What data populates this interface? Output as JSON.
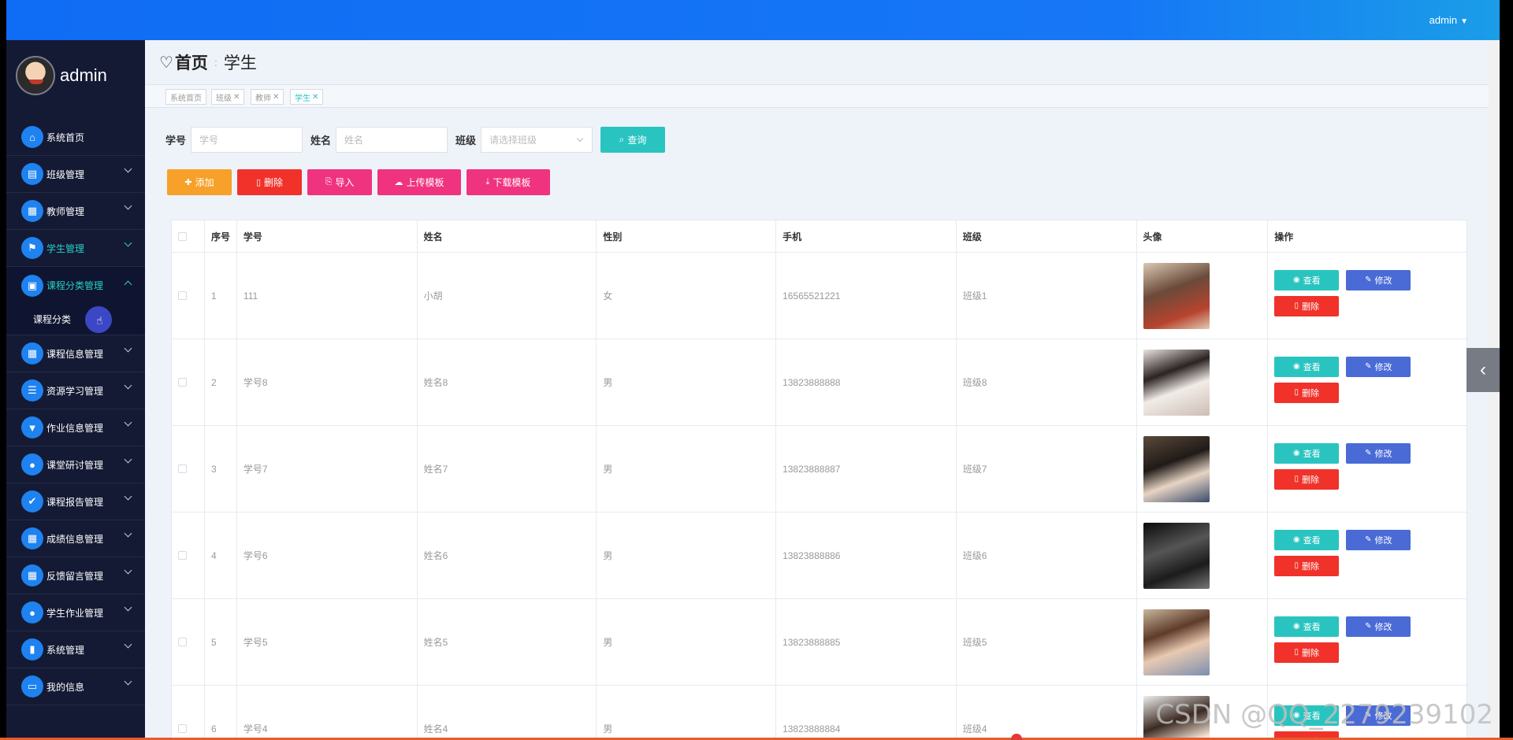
{
  "header": {
    "username": "admin"
  },
  "sidebar": {
    "brand_name": "admin",
    "items": [
      {
        "label": "系统首页",
        "icon": "home-icon"
      },
      {
        "label": "班级管理",
        "icon": "chart-icon"
      },
      {
        "label": "教师管理",
        "icon": "grid-icon"
      },
      {
        "label": "学生管理",
        "icon": "flag-icon"
      },
      {
        "label": "课程分类管理",
        "icon": "briefcase-icon"
      },
      {
        "label": "课程信息管理",
        "icon": "grid-icon"
      },
      {
        "label": "资源学习管理",
        "icon": "list-icon"
      },
      {
        "label": "作业信息管理",
        "icon": "pin-icon"
      },
      {
        "label": "课堂研讨管理",
        "icon": "user-icon"
      },
      {
        "label": "课程报告管理",
        "icon": "clipboard-icon"
      },
      {
        "label": "成绩信息管理",
        "icon": "grid-icon"
      },
      {
        "label": "反馈留言管理",
        "icon": "grid-icon"
      },
      {
        "label": "学生作业管理",
        "icon": "bulb-icon"
      },
      {
        "label": "系统管理",
        "icon": "bar-chart-icon"
      },
      {
        "label": "我的信息",
        "icon": "id-card-icon"
      }
    ],
    "sub_item": "课程分类"
  },
  "page": {
    "home": "首页",
    "current": "学生"
  },
  "tabs": [
    "系统首页",
    "班级",
    "教师",
    "学生"
  ],
  "search": {
    "id_label": "学号",
    "id_placeholder": "学号",
    "name_label": "姓名",
    "name_placeholder": "姓名",
    "class_label": "班级",
    "class_placeholder": "请选择班级",
    "query_button": "查询"
  },
  "toolbar": {
    "add": "添加",
    "delete": "删除",
    "import": "导入",
    "upload_template": "上传模板",
    "download_template": "下载模板"
  },
  "table": {
    "headers": [
      "序号",
      "学号",
      "姓名",
      "性别",
      "手机",
      "班级",
      "头像",
      "操作"
    ],
    "rows": [
      {
        "no": "1",
        "id": "111",
        "name": "小胡",
        "gender": "女",
        "phone": "16565521221",
        "class": "班级1"
      },
      {
        "no": "2",
        "id": "学号8",
        "name": "姓名8",
        "gender": "男",
        "phone": "13823888888",
        "class": "班级8"
      },
      {
        "no": "3",
        "id": "学号7",
        "name": "姓名7",
        "gender": "男",
        "phone": "13823888887",
        "class": "班级7"
      },
      {
        "no": "4",
        "id": "学号6",
        "name": "姓名6",
        "gender": "男",
        "phone": "13823888886",
        "class": "班级6"
      },
      {
        "no": "5",
        "id": "学号5",
        "name": "姓名5",
        "gender": "男",
        "phone": "13823888885",
        "class": "班级5"
      },
      {
        "no": "6",
        "id": "学号4",
        "name": "姓名4",
        "gender": "男",
        "phone": "13823888884",
        "class": "班级4"
      }
    ],
    "ops": {
      "view": "查看",
      "edit": "修改",
      "delete": "删除"
    }
  },
  "watermark": "CSDN @QQ_2279239102",
  "colors": {
    "topbar": "#1677f6",
    "sidebar": "#141a34",
    "teal": "#2ac4c0",
    "orange": "#f7a12a",
    "red": "#f0322a",
    "pink": "#f0337e",
    "edit_blue": "#4a6bd6"
  }
}
